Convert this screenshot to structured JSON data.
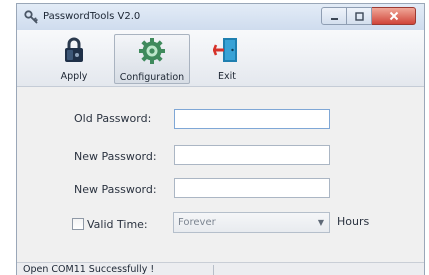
{
  "window": {
    "title": "PasswordTools V2.0",
    "app_icon": "key-icon",
    "controls": {
      "minimize_icon": "minimize-icon",
      "maximize_icon": "maximize-icon",
      "close_icon": "close-icon"
    }
  },
  "toolbar": {
    "items": [
      {
        "label": "Apply",
        "icon": "lock-icon"
      },
      {
        "label": "Configuration",
        "icon": "gear-icon"
      },
      {
        "label": "Exit",
        "icon": "exit-door-icon"
      }
    ]
  },
  "form": {
    "old_password": {
      "label": "Old Password:",
      "value": ""
    },
    "new_password": {
      "label": "New Password:",
      "value": ""
    },
    "confirm_password": {
      "label": "New Password:",
      "value": ""
    },
    "valid_time": {
      "label": "Valid Time:",
      "checked": false,
      "selected": "Forever",
      "unit": "Hours"
    }
  },
  "status": {
    "message": "Open COM11 Successfully !"
  },
  "colors": {
    "title_bar": "#cfdcee",
    "close_button": "#d0453a",
    "window_bg": "#f0f0f0"
  }
}
